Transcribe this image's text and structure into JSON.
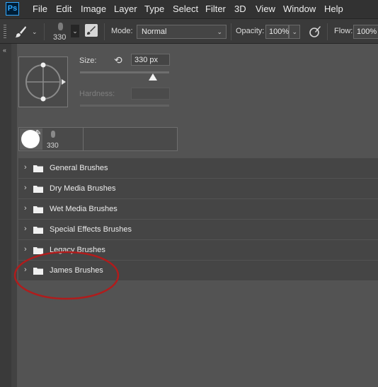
{
  "app": {
    "logo_text": "Ps",
    "logo_color": "#31a8ff"
  },
  "menu": [
    "File",
    "Edit",
    "Image",
    "Layer",
    "Type",
    "Select",
    "Filter",
    "3D",
    "View",
    "Window",
    "Help"
  ],
  "options_bar": {
    "tool_icon": "brush-icon",
    "brush_size": "330",
    "mode_label": "Mode:",
    "mode_value": "Normal",
    "opacity_label": "Opacity:",
    "opacity_value": "100%",
    "flow_label": "Flow:",
    "flow_value": "100%"
  },
  "brush_panel": {
    "size_label": "Size:",
    "size_value": "330 px",
    "size_slider_fraction": 0.82,
    "hardness_label": "Hardness:",
    "recent_brush_size": "330"
  },
  "folders": [
    {
      "name": "General Brushes"
    },
    {
      "name": "Dry Media Brushes"
    },
    {
      "name": "Wet Media Brushes"
    },
    {
      "name": "Special Effects Brushes"
    },
    {
      "name": "Legacy Brushes"
    },
    {
      "name": "James Brushes"
    }
  ],
  "annotation": {
    "highlight_color": "#b01c1c",
    "highlighted_folder": "James Brushes"
  }
}
